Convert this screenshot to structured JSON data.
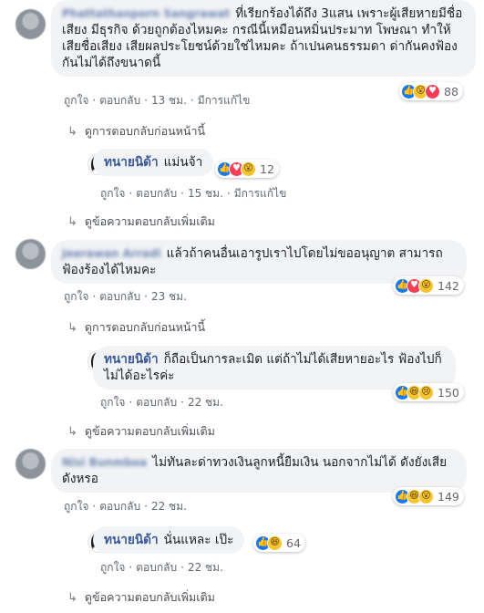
{
  "comments": [
    {
      "author": "Phattathanporn Sangrawat",
      "text": "ที่เรียกร้องได้ถึง 3แสน เพราะผู้เสียหายมีชื่อเสียง มีธุรกิจ ด้วยถูกต้องไหมคะ กรณีนี้เหมือนหมิ่นประมาท โพษณา ทำให้เสียชื่อเสียง เสียผลประโยชน์ด้วยใช่ไหมคะ ถ้าเปนคนธรรมดา ด่ากันคงฟ้องกันไม่ได้ถึงขนาดนี้",
      "reactions": [
        "like-icon",
        "wow-icon",
        "love-icon"
      ],
      "reaction_count": "88",
      "like": "ถูกใจ",
      "reply": "ตอบกลับ",
      "time": "13 ชม.",
      "edited": "มีการแก้ไข",
      "prev_link": "ดูการตอบกลับก่อนหน้านี้",
      "reply_item": {
        "author": "ทนายนิด้า",
        "text": "แม่นจ้า",
        "reactions": [
          "like-icon",
          "love-icon",
          "wow-icon"
        ],
        "reaction_count": "12",
        "like": "ถูกใจ",
        "reply": "ตอบกลับ",
        "time": "15 ชม.",
        "edited": "มีการแก้ไข"
      },
      "more_link": "ดูข้อความตอบกลับเพิ่มเติม"
    },
    {
      "author": "Jeerawan Arradi",
      "text": "แล้วถ้าคนอื่นเอารูปเราไปโดยไม่ขออนุญาต สามารถฟ้องร้องได้ไหมคะ",
      "reactions": [
        "like-icon",
        "love-icon",
        "wow-icon"
      ],
      "reaction_count": "142",
      "like": "ถูกใจ",
      "reply": "ตอบกลับ",
      "time": "23 ชม.",
      "prev_link": "ดูการตอบกลับก่อนหน้านี้",
      "reply_item": {
        "author": "ทนายนิด้า",
        "text": "ก็ถือเป็นการละเมิด แต่ถ้าไม่ได้เสียหายอะไร ฟ้องไปก็ไม่ได้อะไรค่ะ",
        "reactions": [
          "like-icon",
          "haha-icon",
          "sad-icon"
        ],
        "reaction_count": "150",
        "like": "ถูกใจ",
        "reply": "ตอบกลับ",
        "time": "22 ชม."
      },
      "more_link": "ดูข้อความตอบกลับเพิ่มเติม"
    },
    {
      "author": "Nisi Bunmboa",
      "text": "ไม่ทันละด่าทวงเงินลูกหนี้ยืมเงิน นอกจากไม่ได้ ดังยังเสียดังหรอ",
      "reactions": [
        "like-icon",
        "haha-icon",
        "wow-icon"
      ],
      "reaction_count": "149",
      "like": "ถูกใจ",
      "reply": "ตอบกลับ",
      "time": "22 ชม.",
      "reply_item": {
        "author": "ทนายนิด้า",
        "text": "นั่นแหละ เป๊ะ",
        "reactions": [
          "like-icon",
          "haha-icon"
        ],
        "reaction_count": "64",
        "like": "ถูกใจ",
        "reply": "ตอบกลับ",
        "time": "22 ชม."
      },
      "more_link": "ดูข้อความตอบกลับเพิ่มเติม"
    }
  ]
}
